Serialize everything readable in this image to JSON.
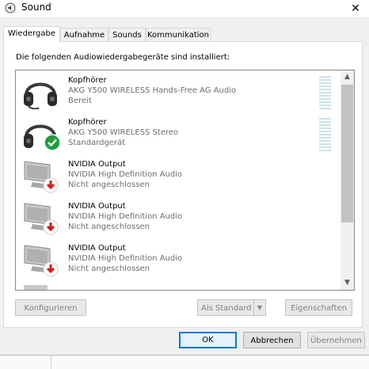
{
  "window": {
    "title": "Sound",
    "close_symbol": "✕"
  },
  "tabs": [
    {
      "label": "Wiedergabe",
      "active": true
    },
    {
      "label": "Aufnahme",
      "active": false
    },
    {
      "label": "Sounds",
      "active": false
    },
    {
      "label": "Kommunikation",
      "active": false
    }
  ],
  "panel": {
    "intro": "Die folgenden Audiowiedergabegeräte sind installiert:"
  },
  "devices": [
    {
      "name": "Kopfhörer",
      "description": "AKG Y500 WIRELESS Hands-Free AG Audio",
      "status": "Bereit",
      "icon": "headphones-icon"
    },
    {
      "name": "Kopfhörer",
      "description": "AKG Y500 WIRELESS Stereo",
      "status": "Standardgerät",
      "icon": "headphones-default-icon"
    },
    {
      "name": "NVIDIA Output",
      "description": "NVIDIA High Definition Audio",
      "status": "Nicht angeschlossen",
      "icon": "monitor-disconnected-icon"
    },
    {
      "name": "NVIDIA Output",
      "description": "NVIDIA High Definition Audio",
      "status": "Nicht angeschlossen",
      "icon": "monitor-disconnected-icon"
    },
    {
      "name": "NVIDIA Output",
      "description": "NVIDIA High Definition Audio",
      "status": "Nicht angeschlossen",
      "icon": "monitor-disconnected-icon"
    }
  ],
  "panel_buttons": {
    "configure": "Konfigurieren",
    "set_default": "Als Standard",
    "properties": "Eigenschaften"
  },
  "dialog_buttons": {
    "ok": "OK",
    "cancel": "Abbrechen",
    "apply": "Übernehmen"
  },
  "colors": {
    "accent": "#0078d7",
    "check_green": "#1f9d3a",
    "warning_red": "#d51818",
    "level_meter": "#cbe2e9"
  }
}
